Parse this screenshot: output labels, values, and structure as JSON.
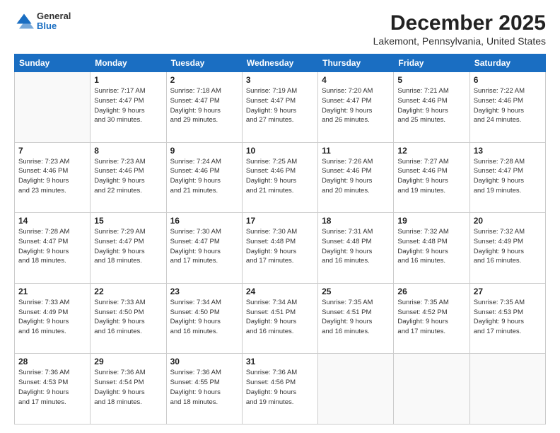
{
  "header": {
    "logo": {
      "general": "General",
      "blue": "Blue"
    },
    "title": "December 2025",
    "subtitle": "Lakemont, Pennsylvania, United States"
  },
  "calendar": {
    "days_of_week": [
      "Sunday",
      "Monday",
      "Tuesday",
      "Wednesday",
      "Thursday",
      "Friday",
      "Saturday"
    ],
    "weeks": [
      [
        {
          "day": "",
          "info": ""
        },
        {
          "day": "1",
          "info": "Sunrise: 7:17 AM\nSunset: 4:47 PM\nDaylight: 9 hours\nand 30 minutes."
        },
        {
          "day": "2",
          "info": "Sunrise: 7:18 AM\nSunset: 4:47 PM\nDaylight: 9 hours\nand 29 minutes."
        },
        {
          "day": "3",
          "info": "Sunrise: 7:19 AM\nSunset: 4:47 PM\nDaylight: 9 hours\nand 27 minutes."
        },
        {
          "day": "4",
          "info": "Sunrise: 7:20 AM\nSunset: 4:47 PM\nDaylight: 9 hours\nand 26 minutes."
        },
        {
          "day": "5",
          "info": "Sunrise: 7:21 AM\nSunset: 4:46 PM\nDaylight: 9 hours\nand 25 minutes."
        },
        {
          "day": "6",
          "info": "Sunrise: 7:22 AM\nSunset: 4:46 PM\nDaylight: 9 hours\nand 24 minutes."
        }
      ],
      [
        {
          "day": "7",
          "info": "Sunrise: 7:23 AM\nSunset: 4:46 PM\nDaylight: 9 hours\nand 23 minutes."
        },
        {
          "day": "8",
          "info": "Sunrise: 7:23 AM\nSunset: 4:46 PM\nDaylight: 9 hours\nand 22 minutes."
        },
        {
          "day": "9",
          "info": "Sunrise: 7:24 AM\nSunset: 4:46 PM\nDaylight: 9 hours\nand 21 minutes."
        },
        {
          "day": "10",
          "info": "Sunrise: 7:25 AM\nSunset: 4:46 PM\nDaylight: 9 hours\nand 21 minutes."
        },
        {
          "day": "11",
          "info": "Sunrise: 7:26 AM\nSunset: 4:46 PM\nDaylight: 9 hours\nand 20 minutes."
        },
        {
          "day": "12",
          "info": "Sunrise: 7:27 AM\nSunset: 4:46 PM\nDaylight: 9 hours\nand 19 minutes."
        },
        {
          "day": "13",
          "info": "Sunrise: 7:28 AM\nSunset: 4:47 PM\nDaylight: 9 hours\nand 19 minutes."
        }
      ],
      [
        {
          "day": "14",
          "info": "Sunrise: 7:28 AM\nSunset: 4:47 PM\nDaylight: 9 hours\nand 18 minutes."
        },
        {
          "day": "15",
          "info": "Sunrise: 7:29 AM\nSunset: 4:47 PM\nDaylight: 9 hours\nand 18 minutes."
        },
        {
          "day": "16",
          "info": "Sunrise: 7:30 AM\nSunset: 4:47 PM\nDaylight: 9 hours\nand 17 minutes."
        },
        {
          "day": "17",
          "info": "Sunrise: 7:30 AM\nSunset: 4:48 PM\nDaylight: 9 hours\nand 17 minutes."
        },
        {
          "day": "18",
          "info": "Sunrise: 7:31 AM\nSunset: 4:48 PM\nDaylight: 9 hours\nand 16 minutes."
        },
        {
          "day": "19",
          "info": "Sunrise: 7:32 AM\nSunset: 4:48 PM\nDaylight: 9 hours\nand 16 minutes."
        },
        {
          "day": "20",
          "info": "Sunrise: 7:32 AM\nSunset: 4:49 PM\nDaylight: 9 hours\nand 16 minutes."
        }
      ],
      [
        {
          "day": "21",
          "info": "Sunrise: 7:33 AM\nSunset: 4:49 PM\nDaylight: 9 hours\nand 16 minutes."
        },
        {
          "day": "22",
          "info": "Sunrise: 7:33 AM\nSunset: 4:50 PM\nDaylight: 9 hours\nand 16 minutes."
        },
        {
          "day": "23",
          "info": "Sunrise: 7:34 AM\nSunset: 4:50 PM\nDaylight: 9 hours\nand 16 minutes."
        },
        {
          "day": "24",
          "info": "Sunrise: 7:34 AM\nSunset: 4:51 PM\nDaylight: 9 hours\nand 16 minutes."
        },
        {
          "day": "25",
          "info": "Sunrise: 7:35 AM\nSunset: 4:51 PM\nDaylight: 9 hours\nand 16 minutes."
        },
        {
          "day": "26",
          "info": "Sunrise: 7:35 AM\nSunset: 4:52 PM\nDaylight: 9 hours\nand 17 minutes."
        },
        {
          "day": "27",
          "info": "Sunrise: 7:35 AM\nSunset: 4:53 PM\nDaylight: 9 hours\nand 17 minutes."
        }
      ],
      [
        {
          "day": "28",
          "info": "Sunrise: 7:36 AM\nSunset: 4:53 PM\nDaylight: 9 hours\nand 17 minutes."
        },
        {
          "day": "29",
          "info": "Sunrise: 7:36 AM\nSunset: 4:54 PM\nDaylight: 9 hours\nand 18 minutes."
        },
        {
          "day": "30",
          "info": "Sunrise: 7:36 AM\nSunset: 4:55 PM\nDaylight: 9 hours\nand 18 minutes."
        },
        {
          "day": "31",
          "info": "Sunrise: 7:36 AM\nSunset: 4:56 PM\nDaylight: 9 hours\nand 19 minutes."
        },
        {
          "day": "",
          "info": ""
        },
        {
          "day": "",
          "info": ""
        },
        {
          "day": "",
          "info": ""
        }
      ]
    ]
  }
}
